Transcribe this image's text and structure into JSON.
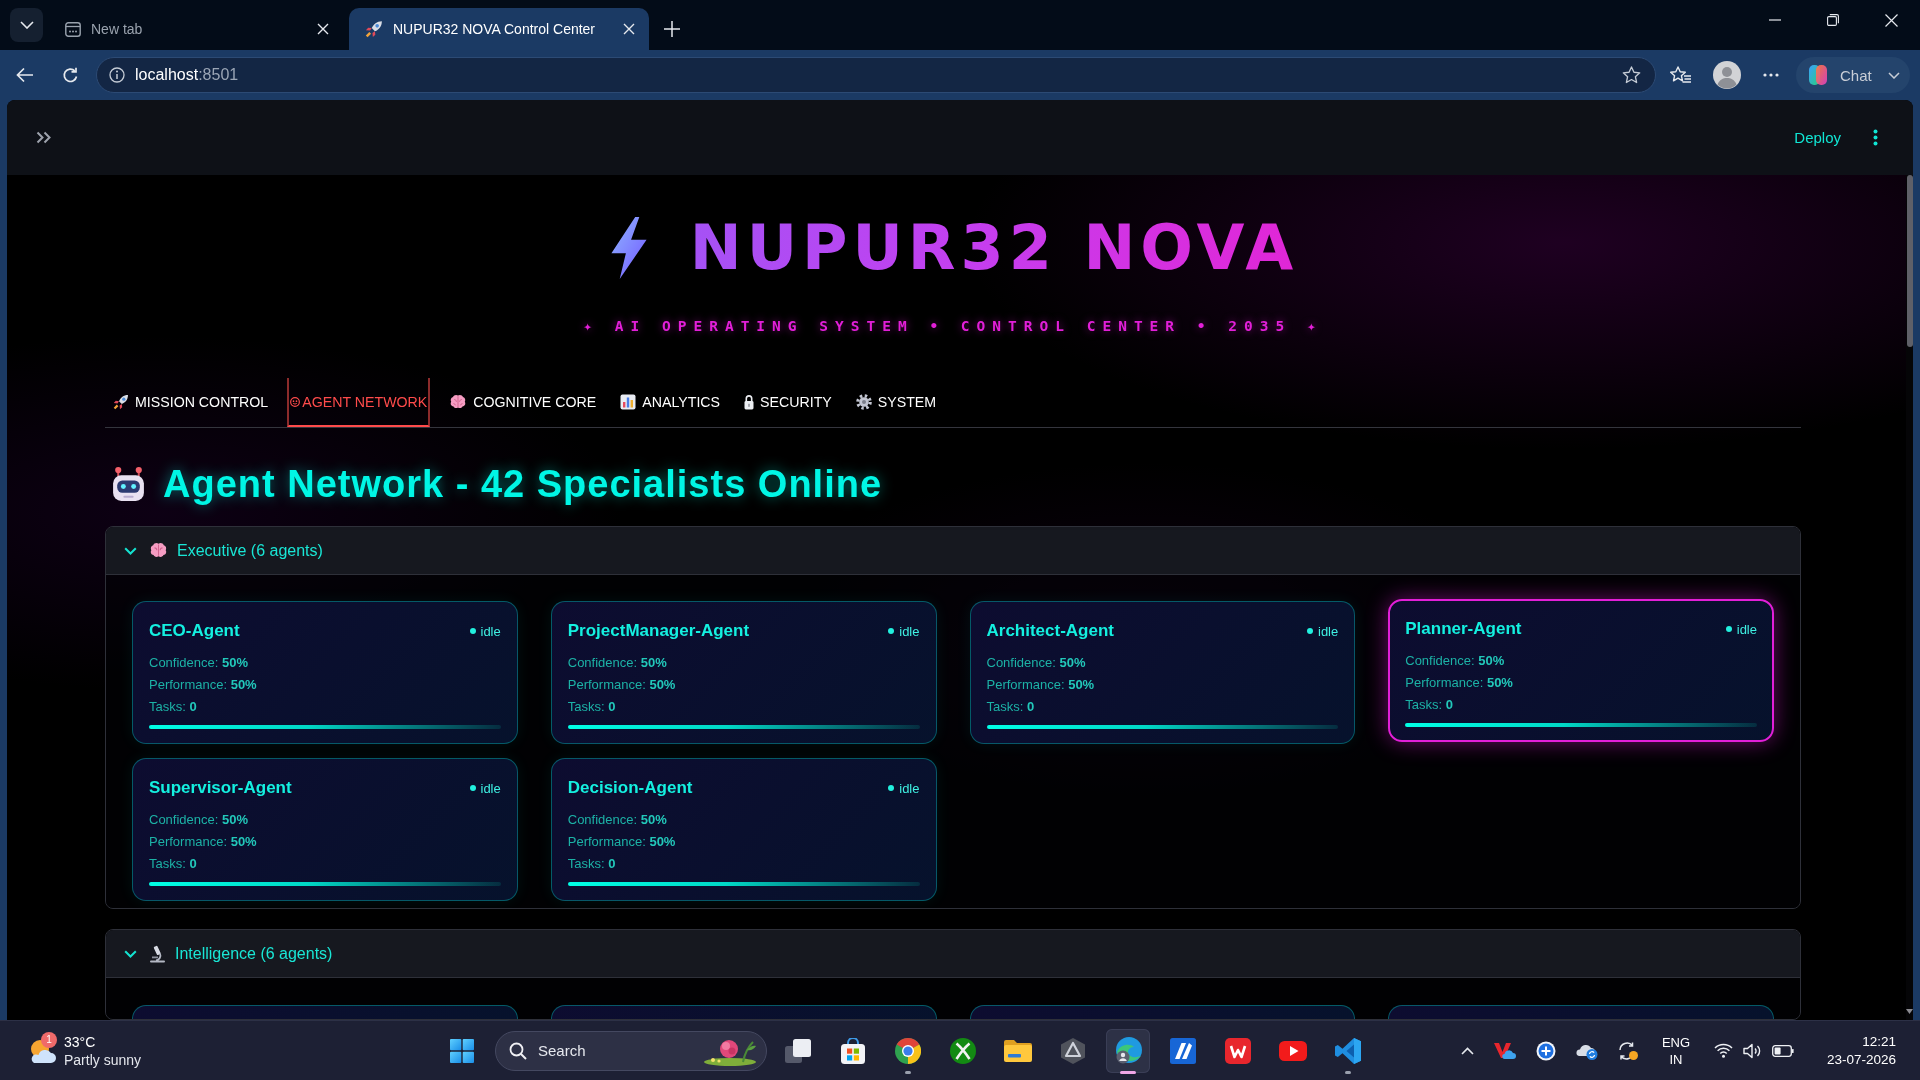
{
  "browser": {
    "tabs": [
      {
        "title": "New tab",
        "selected": false
      },
      {
        "title": "NUPUR32 NOVA Control Center",
        "selected": true
      }
    ],
    "address": {
      "host": "localhost",
      "port": ":8501"
    },
    "chat": "Chat"
  },
  "app_header": {
    "deploy": "Deploy"
  },
  "hero": {
    "title": "NUPUR32 NOVA",
    "subtitle": "✦ AI OPERATING SYSTEM • CONTROL CENTER • 2035 ✦"
  },
  "nav_tabs": [
    {
      "label": "MISSION CONTROL",
      "selected": false
    },
    {
      "label": "AGENT NETWORK",
      "selected": true
    },
    {
      "label": "COGNITIVE CORE",
      "selected": false
    },
    {
      "label": "ANALYTICS",
      "selected": false
    },
    {
      "label": "SECURITY",
      "selected": false
    },
    {
      "label": "SYSTEM",
      "selected": false
    }
  ],
  "page_heading": "Agent Network - 42 Specialists Online",
  "groups": [
    {
      "title": "Executive (6 agents)",
      "expanded": true,
      "agents": [
        {
          "kind": "card",
          "name": "CEO-Agent",
          "status": "idle",
          "stats": [
            "Confidence: **50%**",
            "Performance: **50%**",
            "Tasks: **0**"
          ],
          "highlighted": false
        },
        {
          "kind": "card",
          "name": "ProjectManager-Agent",
          "status": "idle",
          "stats": [
            "Confidence: **50%**",
            "Performance: **50%**",
            "Tasks: **0**"
          ],
          "highlighted": false
        },
        {
          "kind": "card",
          "name": "Architect-Agent",
          "status": "idle",
          "stats": [
            "Confidence: **50%**",
            "Performance: **50%**",
            "Tasks: **0**"
          ],
          "highlighted": false
        },
        {
          "kind": "card",
          "name": "Planner-Agent",
          "status": "idle",
          "stats": [
            "Confidence: **50%**",
            "Performance: **50%**",
            "Tasks: **0**"
          ],
          "highlighted": true
        },
        {
          "kind": "card",
          "name": "Supervisor-Agent",
          "status": "idle",
          "stats": [
            "Confidence: **50%**",
            "Performance: **50%**",
            "Tasks: **0**"
          ],
          "highlighted": false
        },
        {
          "kind": "card",
          "name": "Decision-Agent",
          "status": "idle",
          "stats": [
            "Confidence: **50%**",
            "Performance: **50%**",
            "Tasks: **0**"
          ],
          "highlighted": false
        }
      ]
    },
    {
      "title": "Intelligence (6 agents)",
      "expanded": true,
      "agents": [
        {
          "kind": "cut_off"
        },
        {
          "kind": "cut_off"
        },
        {
          "kind": "cut_off"
        },
        {
          "kind": "cut_off"
        }
      ]
    }
  ],
  "taskbar": {
    "weather": {
      "badge": "1",
      "temperature": "33°C",
      "condition": "Partly sunny"
    },
    "search": {
      "placeholder": "Search"
    },
    "apps": [
      {
        "running": false,
        "selected": false
      },
      {
        "running": false,
        "selected": false
      },
      {
        "running": true,
        "selected": false
      },
      {
        "running": false,
        "selected": false
      },
      {
        "running": false,
        "selected": false
      },
      {
        "running": false,
        "selected": false
      },
      {
        "running": true,
        "selected": true
      },
      {
        "running": false,
        "selected": false
      },
      {
        "running": false,
        "selected": false
      },
      {
        "running": false,
        "selected": false
      },
      {
        "running": true,
        "selected": false
      }
    ],
    "tray": {
      "language": "ENG",
      "region": "IN"
    },
    "clock": {
      "time": "12:21",
      "date": "23-07-2026"
    }
  }
}
